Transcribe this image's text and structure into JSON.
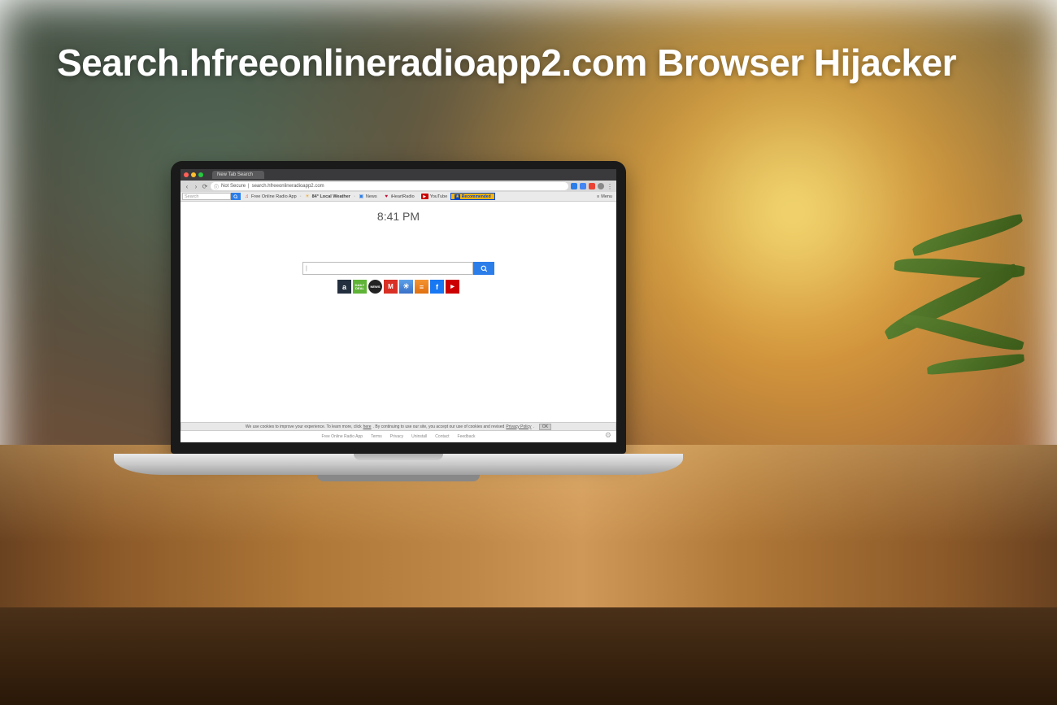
{
  "headline": "Search.hfreeonlineradioapp2.com Browser Hijacker",
  "browser": {
    "tab_title": "New Tab Search",
    "address": {
      "security_label": "Not Secure",
      "url": "search.hfreeonlineradioapp2.com"
    }
  },
  "bookmark_bar": {
    "search_placeholder": "Search",
    "items": [
      {
        "label": "Free Online Radio App",
        "icon": "radio-icon",
        "color": "#d93025"
      },
      {
        "label": "84° Local Weather",
        "icon": "sun-icon",
        "color": "#f5a623"
      },
      {
        "label": "News",
        "icon": "news-icon",
        "color": "#2b7de9"
      },
      {
        "label": "iHeartRadio",
        "icon": "heart-icon",
        "color": "#c6002b"
      },
      {
        "label": "YouTube",
        "icon": "youtube-icon",
        "color": "#cc0000"
      }
    ],
    "recommended_label": "Recommended",
    "menu_label": "Menu"
  },
  "page": {
    "clock": "8:41 PM",
    "search_placeholder": "",
    "shortcuts": [
      {
        "name": "amazon",
        "glyph": "a"
      },
      {
        "name": "daily-deal",
        "glyph": "DAILY DEAL"
      },
      {
        "name": "world-news",
        "glyph": "NEWS"
      },
      {
        "name": "gmail",
        "glyph": "M"
      },
      {
        "name": "weather",
        "glyph": "☀"
      },
      {
        "name": "booking",
        "glyph": "≡"
      },
      {
        "name": "facebook",
        "glyph": "f"
      },
      {
        "name": "youtube",
        "glyph": "▶"
      }
    ]
  },
  "cookie": {
    "text_pre": "We use cookies to improve your experience. To learn more, click ",
    "here": "here",
    "text_mid": ". By continuing to use our site, you accept our use of cookies and revised ",
    "policy": "Privacy Policy",
    "ok": "OK"
  },
  "footer": {
    "links": [
      "Free Online Radio App",
      "Terms",
      "Privacy",
      "Uninstall",
      "Contact",
      "Feedback"
    ]
  }
}
